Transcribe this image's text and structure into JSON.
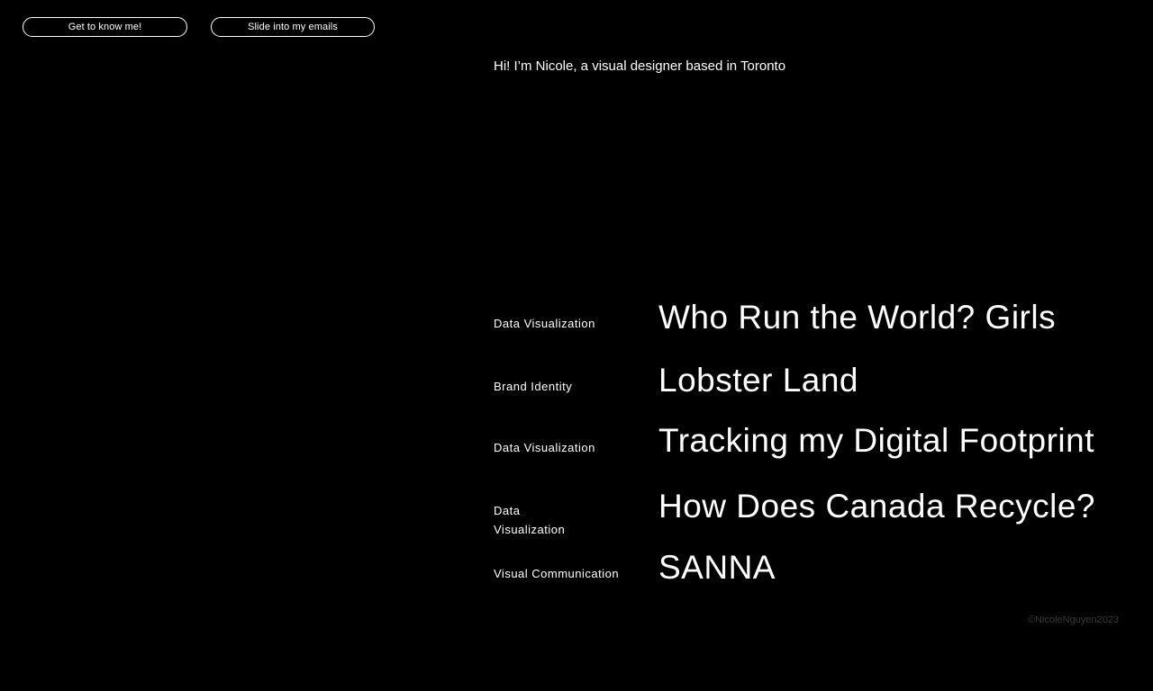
{
  "nav": {
    "about_label": "Get to know me!",
    "email_label": "Slide into my emails"
  },
  "intro": {
    "text": "Hi! I’m Nicole, a visual designer based in Toronto"
  },
  "projects": [
    {
      "category": "Data Visualization",
      "title": "Who Run the World? Girls"
    },
    {
      "category": "Brand Identity",
      "title": "Lobster Land"
    },
    {
      "category": "Data Visualization",
      "title": "Tracking my Digital Footprint"
    },
    {
      "category": "Data Visualization",
      "title": "How Does Canada Recycle?"
    },
    {
      "category": "Visual Communication",
      "title": "SANNA"
    }
  ],
  "footer": {
    "copyright": "©NicoleNguyen2023"
  },
  "colors": {
    "background": "#000000",
    "text": "#ffffff",
    "footer_text": "#3a3a3a"
  }
}
